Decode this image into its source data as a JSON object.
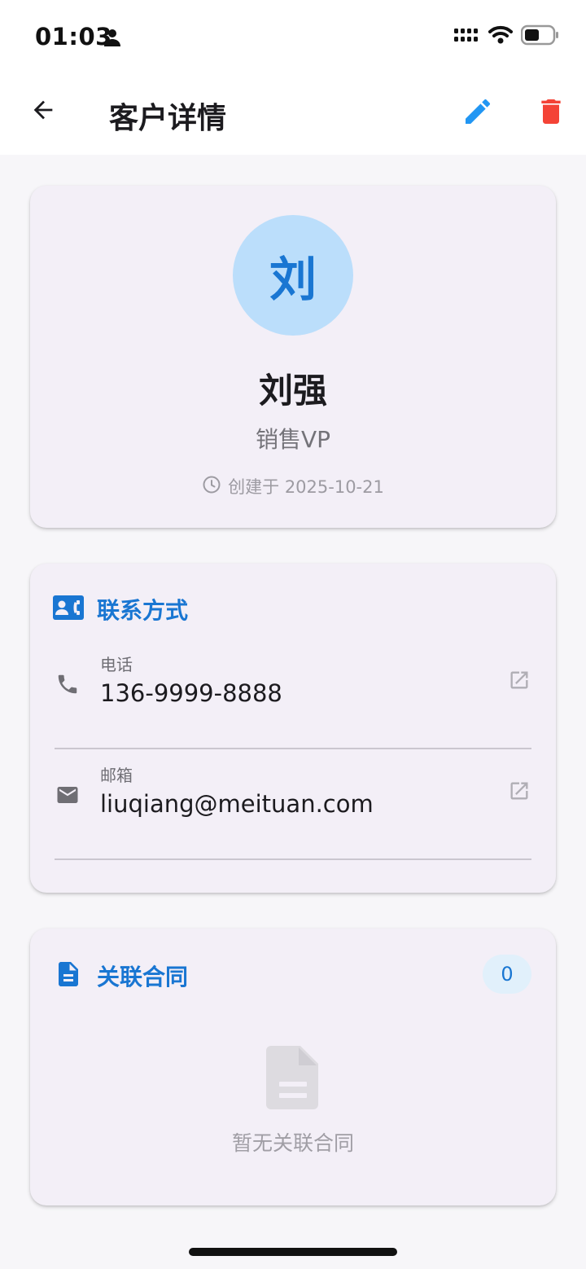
{
  "status_bar": {
    "time": "01:03",
    "icons": [
      "person-icon",
      "signal-icon",
      "wifi-icon",
      "battery-icon"
    ]
  },
  "app_bar": {
    "title": "客户详情",
    "back_icon": "arrow-back-icon",
    "edit_icon": "edit-pencil-icon",
    "delete_icon": "trash-icon",
    "colors": {
      "edit": "#2196f3",
      "delete": "#f44336"
    }
  },
  "profile": {
    "avatar_initial": "刘",
    "name": "刘强",
    "title": "销售VP",
    "created": "创建于 2025-10-21"
  },
  "contact": {
    "section_title": "联系方式",
    "items": [
      {
        "label": "电话",
        "value": "136-9999-8888",
        "icon": "phone-icon"
      },
      {
        "label": "邮箱",
        "value": "liuqiang@meituan.com",
        "icon": "mail-icon"
      }
    ]
  },
  "contracts": {
    "section_title": "关联合同",
    "count": "0",
    "empty_text": "暂无关联合同"
  },
  "colors": {
    "accent": "#1976d2",
    "avatar_bg": "#bbdefb",
    "card_bg": "#f3eff7",
    "page_bg": "#f7f6f9"
  }
}
